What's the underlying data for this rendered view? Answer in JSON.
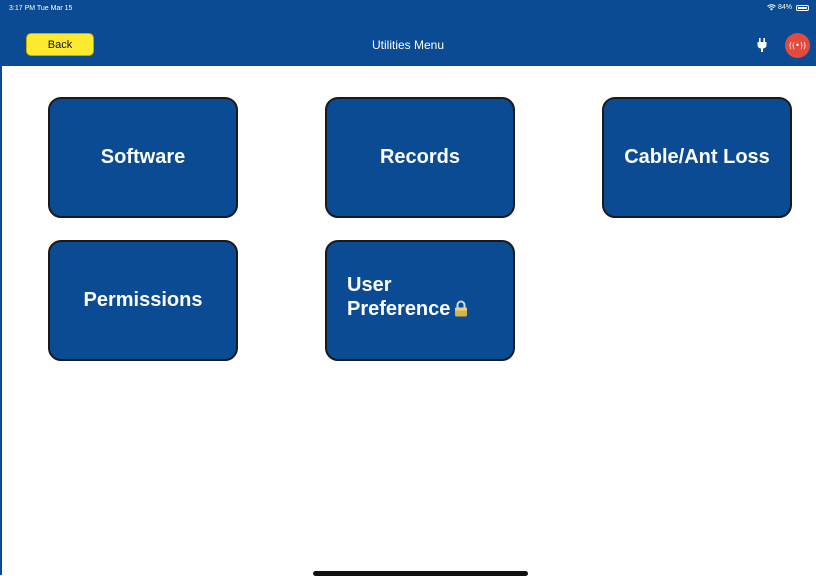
{
  "status_bar": {
    "time": "3:17 PM  Tue Mar 15",
    "battery_text": "84%",
    "battery_level": 0.84
  },
  "nav": {
    "back_label": "Back",
    "title": "Utilities Menu",
    "plug_icon": "plug-icon",
    "broadcast_icon": "broadcast-icon",
    "broadcast_glyph": "((•))"
  },
  "menu": {
    "tiles": [
      {
        "label": "Software"
      },
      {
        "label": "Records"
      },
      {
        "label": "Cable/Ant Loss"
      },
      {
        "label": "Permissions"
      },
      {
        "label_line1": "User",
        "label_line2": "Preference",
        "icon": "lock-icon"
      }
    ]
  },
  "colors": {
    "primary": "#0b4b94",
    "back_button": "#fde92d",
    "broadcast": "#e34b3c"
  }
}
